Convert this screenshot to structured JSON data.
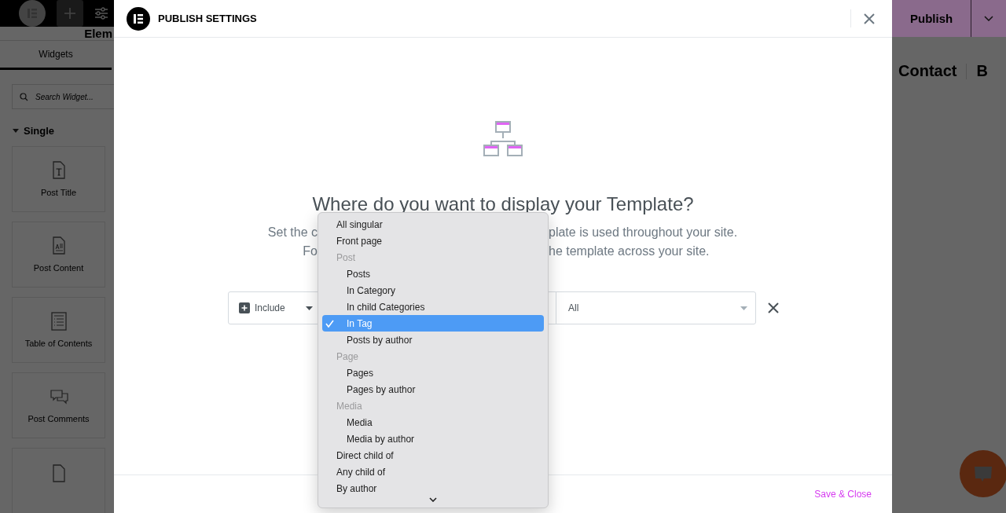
{
  "editor_sidebar": {
    "header_title": "Elem",
    "tabs": [
      {
        "label": "Widgets",
        "selected": true
      }
    ],
    "search": {
      "placeholder": "Search Widget..."
    },
    "category": {
      "label": "Single",
      "expanded": true
    },
    "widgets": [
      {
        "kind": "title",
        "label": "Post Title"
      },
      {
        "kind": "content",
        "label": "Post Content"
      },
      {
        "kind": "toc",
        "label": "Table of Contents"
      },
      {
        "kind": "comments",
        "label": "Post Comments"
      },
      {
        "kind": "partial"
      }
    ]
  },
  "site_preview": {
    "publish_button": "Publish",
    "nav_items": [
      "Contact",
      "B"
    ]
  },
  "modal": {
    "title": "PUBLISH SETTINGS",
    "heading": "Where do you want to display your Template?",
    "description_lines": [
      {
        "before": "Set the c",
        "after": "plate is used throughout your site."
      },
      {
        "before": "Fo",
        "after": "he template across your site."
      }
    ],
    "condition": {
      "type": "Include",
      "value": "All"
    },
    "dropdown": [
      {
        "kind": "option",
        "label": "All singular",
        "selected": false
      },
      {
        "kind": "option",
        "label": "Front page",
        "selected": false
      },
      {
        "kind": "group",
        "label": "Post",
        "children": [
          {
            "kind": "option",
            "label": "Posts",
            "selected": false
          },
          {
            "kind": "option",
            "label": "In Category",
            "selected": false
          },
          {
            "kind": "option",
            "label": "In child Categories",
            "selected": false
          },
          {
            "kind": "option",
            "label": "In Tag",
            "selected": true
          },
          {
            "kind": "option",
            "label": "Posts by author",
            "selected": false
          }
        ]
      },
      {
        "kind": "group",
        "label": "Page",
        "children": [
          {
            "kind": "option",
            "label": "Pages",
            "selected": false
          },
          {
            "kind": "option",
            "label": "Pages by author",
            "selected": false
          }
        ]
      },
      {
        "kind": "group",
        "label": "Media",
        "children": [
          {
            "kind": "option",
            "label": "Media",
            "selected": false
          },
          {
            "kind": "option",
            "label": "Media by author",
            "selected": false
          }
        ]
      },
      {
        "kind": "option",
        "label": "Direct child of",
        "selected": false
      },
      {
        "kind": "option",
        "label": "Any child of",
        "selected": false
      },
      {
        "kind": "option",
        "label": "By author",
        "selected": false
      }
    ],
    "save_button": "Save & Close"
  }
}
